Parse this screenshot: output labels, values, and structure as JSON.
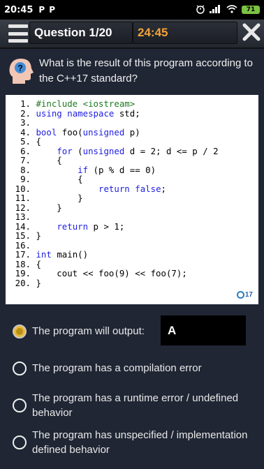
{
  "status_bar": {
    "time": "20:45",
    "left_icons": [
      "P",
      "P"
    ],
    "battery": "71"
  },
  "header": {
    "title": "Question 1/20",
    "timer": "24:45"
  },
  "question": {
    "text": "What is the result of this program according to the C++17 standard?"
  },
  "code": {
    "lines": [
      {
        "n": "1.",
        "t": "#include <iostream>"
      },
      {
        "n": "2.",
        "t": "using namespace std;"
      },
      {
        "n": "3.",
        "t": ""
      },
      {
        "n": "4.",
        "t": "bool foo(unsigned p)"
      },
      {
        "n": "5.",
        "t": "{"
      },
      {
        "n": "6.",
        "t": "    for (unsigned d = 2; d <= p / 2"
      },
      {
        "n": "7.",
        "t": "    {"
      },
      {
        "n": "8.",
        "t": "        if (p % d == 0)"
      },
      {
        "n": "9.",
        "t": "        {"
      },
      {
        "n": "10.",
        "t": "            return false;"
      },
      {
        "n": "11.",
        "t": "        }"
      },
      {
        "n": "12.",
        "t": "    }"
      },
      {
        "n": "13.",
        "t": ""
      },
      {
        "n": "14.",
        "t": "    return p > 1;"
      },
      {
        "n": "15.",
        "t": "}"
      },
      {
        "n": "16.",
        "t": ""
      },
      {
        "n": "17.",
        "t": "int main()"
      },
      {
        "n": "18.",
        "t": "{"
      },
      {
        "n": "19.",
        "t": "    cout << foo(9) << foo(7);"
      },
      {
        "n": "20.",
        "t": "}"
      }
    ],
    "standard_badge": "17"
  },
  "options": [
    {
      "label": "The program will output:",
      "selected": true
    },
    {
      "label": "The program has a compilation error",
      "selected": false
    },
    {
      "label": "The program has a runtime error / undefined behavior",
      "selected": false
    },
    {
      "label": "The program has unspecified / implementation defined behavior",
      "selected": false
    }
  ],
  "answer_input": {
    "value": "A"
  },
  "colors": {
    "background": "#202634",
    "timer": "#f2a33a",
    "selected_radio": "#e7b93c",
    "keyword": "#1e1ee0",
    "preprocessor": "#1c7a20"
  }
}
